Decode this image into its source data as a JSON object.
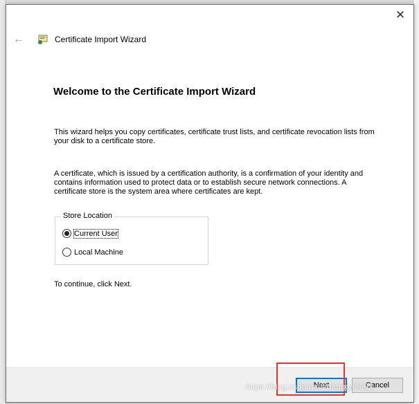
{
  "window": {
    "close_glyph": "✕"
  },
  "header": {
    "back_glyph": "←",
    "title": "Certificate Import Wizard",
    "icon": "certificate-icon"
  },
  "main": {
    "heading": "Welcome to the Certificate Import Wizard",
    "para1": "This wizard helps you copy certificates, certificate trust lists, and certificate revocation lists from your disk to a certificate store.",
    "para2": "A certificate, which is issued by a certification authority, is a confirmation of your identity and contains information used to protect data or to establish secure network connections. A certificate store is the system area where certificates are kept.",
    "store_location": {
      "label": "Store Location",
      "options": [
        {
          "label": "Current User",
          "selected": true
        },
        {
          "label": "Local Machine",
          "selected": false
        }
      ]
    },
    "continue_text": "To continue, click Next."
  },
  "footer": {
    "next_label": "Next",
    "cancel_label": "Cancel"
  },
  "watermark": "https://blog.csdn.net/zhangge3663",
  "colors": {
    "highlight": "#e53333",
    "accent": "#0078d7"
  }
}
